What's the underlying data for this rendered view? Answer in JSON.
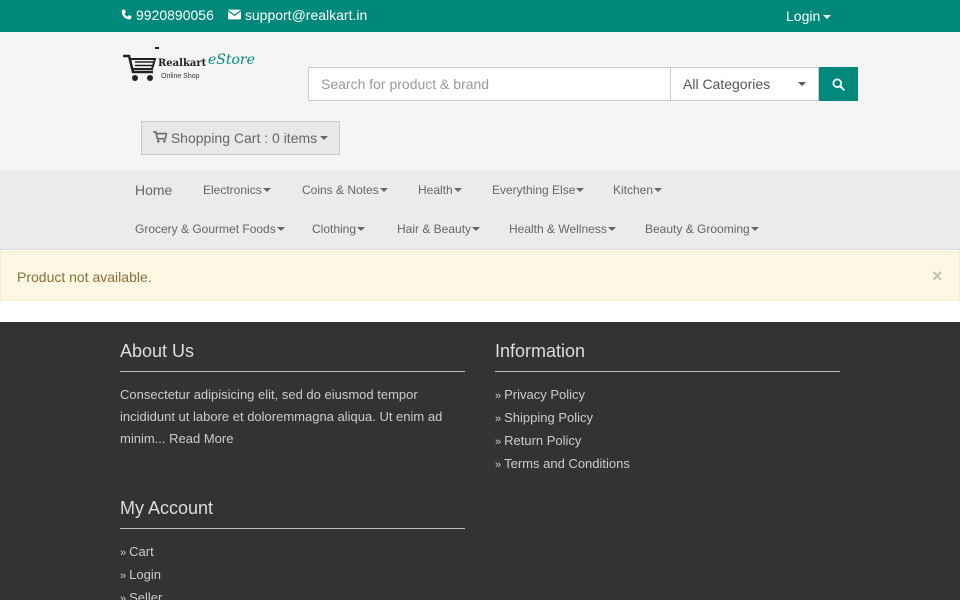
{
  "topbar": {
    "phone": "9920890056",
    "email": "support@realkart.in",
    "login_label": "Login",
    "bg_color": "#00897b"
  },
  "logo": {
    "brand": "Realkart",
    "subtitle": "Online Shop",
    "estore": "eStore"
  },
  "search": {
    "placeholder": "Search for product & brand",
    "category": "All Categories",
    "button_icon": "search-icon"
  },
  "cart": {
    "label": "Shopping Cart : 0 items",
    "icon": "cart-icon"
  },
  "nav": {
    "row1": [
      "Home",
      "Electronics",
      "Coins & Notes",
      "Health",
      "Everything Else",
      "Kitchen"
    ],
    "row2": [
      "Grocery & Gourmet Foods",
      "Clothing",
      "Hair & Beauty",
      "Health & Wellness",
      "Beauty & Grooming"
    ]
  },
  "alert": {
    "message": "Product not available.",
    "close": "×"
  },
  "footer": {
    "about": {
      "title": "About Us",
      "text": "Consectetur adipisicing elit, sed do eiusmod tempor incididunt ut labore et doloremmagna aliqua. Ut enim ad minim...",
      "read_more": "Read More"
    },
    "information": {
      "title": "Information",
      "links": [
        "Privacy Policy",
        "Shipping Policy",
        "Return Policy",
        "Terms and Conditions"
      ]
    },
    "account": {
      "title": "My Account",
      "links": [
        "Cart",
        "Login",
        "Seller"
      ]
    }
  }
}
